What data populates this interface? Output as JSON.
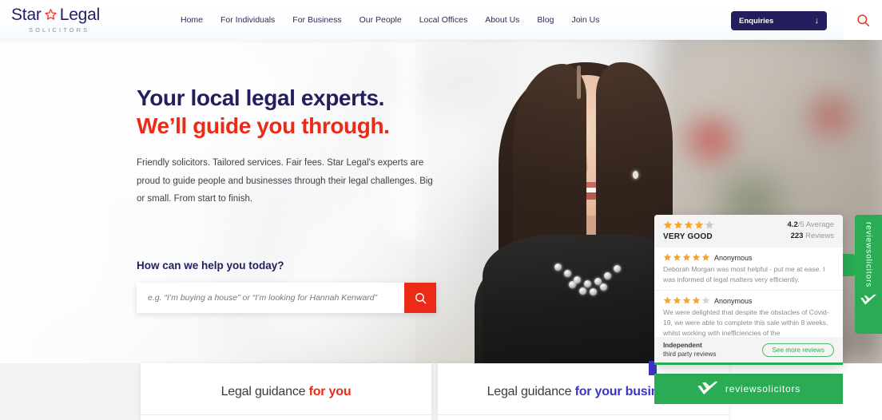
{
  "brand": {
    "name_part1": "Star",
    "name_part2": "Legal",
    "tagline": "SOLICITORS",
    "star_icon": "star-outline-icon",
    "navy": "#231f5e",
    "red": "#ec2a18",
    "green": "#2aac54",
    "blue": "#3a34c8"
  },
  "header": {
    "nav": [
      {
        "label": "Home"
      },
      {
        "label": "For Individuals"
      },
      {
        "label": "For Business"
      },
      {
        "label": "Our People"
      },
      {
        "label": "Local Offices"
      },
      {
        "label": "About Us"
      },
      {
        "label": "Blog"
      },
      {
        "label": "Join Us"
      }
    ],
    "enquiries": {
      "label": "Enquiries",
      "arrow": "↓",
      "icon": "arrow-down-icon"
    },
    "search_toggle_icon": "search-icon"
  },
  "hero": {
    "headline_line1": "Your local legal experts.",
    "headline_line2": "We’ll guide you through.",
    "body": "Friendly solicitors. Tailored services. Fair fees. Star Legal's experts are proud to guide people and businesses through their legal challenges. Big or small. From start to finish.",
    "image_alt": "smiling-woman-portrait"
  },
  "search": {
    "heading": "How can we help you today?",
    "placeholder": "e.g. “I’m buying a house” or “I’m looking for Hannah Kenward”",
    "value": "",
    "submit_icon": "search-icon"
  },
  "guidance_cards": [
    {
      "prefix": "Legal guidance ",
      "accent": "for you",
      "accent_color_key": "red"
    },
    {
      "prefix": "Legal guidance ",
      "accent": "for your business",
      "accent_color_key": "blue"
    }
  ],
  "review_widget": {
    "summary": {
      "stars_filled": 4,
      "stars_total": 5,
      "verdict": "VERY GOOD",
      "score": "4.2",
      "score_suffix": "/5 Average",
      "review_count": "223",
      "review_count_suffix": " Reviews"
    },
    "reviews": [
      {
        "stars": 5,
        "author": "Anonymous",
        "text": "Deborah Morgan was most helpful - put me at ease. I was informed of legal matters very efficiently."
      },
      {
        "stars": 4,
        "author": "Anonymous",
        "text": "We were delighted that despite the obstacles of Covid-19, we were able to complete this sale within 8 weeks, whilst working with inefficiencies of the"
      }
    ],
    "footer": {
      "line1": "Independent",
      "line2": "third party reviews",
      "more_button": "See more reviews"
    },
    "banner": {
      "label": "reviewsolicitors",
      "icon": "checkmark-logo-icon"
    },
    "side_tab": {
      "label": "reviewsolicitors",
      "icon": "checkmark-logo-icon"
    }
  }
}
